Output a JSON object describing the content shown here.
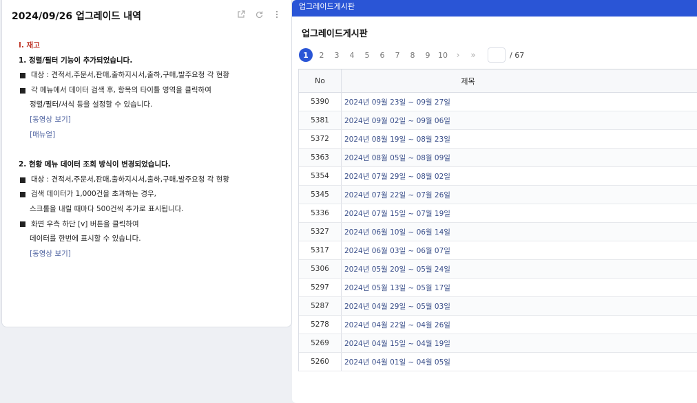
{
  "note": {
    "title": "2024/09/26 업그레이드 내역",
    "section": "Ⅰ. 재고",
    "items": [
      {
        "type": "bold",
        "text": "1. 정렬/필터 기능이 추가되었습니다."
      },
      {
        "type": "bullet",
        "text": "대상 : 견적서,주문서,판매,출하지시서,출하,구매,발주요청 각 현황"
      },
      {
        "type": "bullet",
        "text": "각 메뉴에서 데이터 검색 후, 항목의 타이틀 영역을 클릭하여"
      },
      {
        "type": "indent",
        "text": "정렬/필터/서식 등을 설정할 수 있습니다."
      },
      {
        "type": "link",
        "text": "[동영상 보기]"
      },
      {
        "type": "link",
        "text": "[매뉴얼]"
      },
      {
        "type": "spacer",
        "text": ""
      },
      {
        "type": "bold",
        "text": "2. 현황 메뉴 데이터 조회 방식이 변경되었습니다."
      },
      {
        "type": "bullet",
        "text": "대상 : 견적서,주문서,판매,출하지시서,출하,구매,발주요청 각 현황"
      },
      {
        "type": "bullet",
        "text": "검색 데이터가 1,000건을 초과하는 경우,"
      },
      {
        "type": "indent",
        "text": "스크롤을 내릴 때마다 500건씩 추가로 표시됩니다."
      },
      {
        "type": "bullet",
        "text": "화면 우측 하단 [v] 버튼을 클릭하여"
      },
      {
        "type": "indent",
        "text": "데이터를 한번에 표시할 수 있습니다."
      },
      {
        "type": "link",
        "text": "[동영상 보기]"
      }
    ]
  },
  "board": {
    "topbar": "업그레이드게시판",
    "title": "업그레이드게시판",
    "pager": {
      "pages": [
        "1",
        "2",
        "3",
        "4",
        "5",
        "6",
        "7",
        "8",
        "9",
        "10"
      ],
      "active": "1",
      "next": "›",
      "last": "»",
      "input_value": "",
      "total": "/ 67"
    },
    "columns": {
      "no": "No",
      "title": "제목"
    },
    "rows": [
      {
        "no": "5390",
        "title": "2024년 09월 23일 ~ 09월 27일"
      },
      {
        "no": "5381",
        "title": "2024년 09월 02일 ~ 09월 06일"
      },
      {
        "no": "5372",
        "title": "2024년 08월 19일 ~ 08월 23일"
      },
      {
        "no": "5363",
        "title": "2024년 08월 05일 ~ 08월 09일"
      },
      {
        "no": "5354",
        "title": "2024년 07월 29일 ~ 08월 02일"
      },
      {
        "no": "5345",
        "title": "2024년 07월 22일 ~ 07월 26일"
      },
      {
        "no": "5336",
        "title": "2024년 07월 15일 ~ 07월 19일"
      },
      {
        "no": "5327",
        "title": "2024년 06월 10일 ~ 06월 14일"
      },
      {
        "no": "5317",
        "title": "2024년 06월 03일 ~ 06월 07일"
      },
      {
        "no": "5306",
        "title": "2024년 05월 20일 ~ 05월 24일"
      },
      {
        "no": "5297",
        "title": "2024년 05월 13일 ~ 05월 17일"
      },
      {
        "no": "5287",
        "title": "2024년 04월 29일 ~ 05월 03일"
      },
      {
        "no": "5278",
        "title": "2024년 04월 22일 ~ 04월 26일"
      },
      {
        "no": "5269",
        "title": "2024년 04월 15일 ~ 04월 19일"
      },
      {
        "no": "5260",
        "title": "2024년 04월 01일 ~ 04월 05일"
      }
    ]
  },
  "icons": {
    "open": "external-link-icon",
    "refresh": "refresh-icon",
    "more": "more-vertical-icon"
  },
  "colors": {
    "accent": "#2a55d6",
    "section": "#c0392b",
    "link": "#4a5f9e"
  }
}
